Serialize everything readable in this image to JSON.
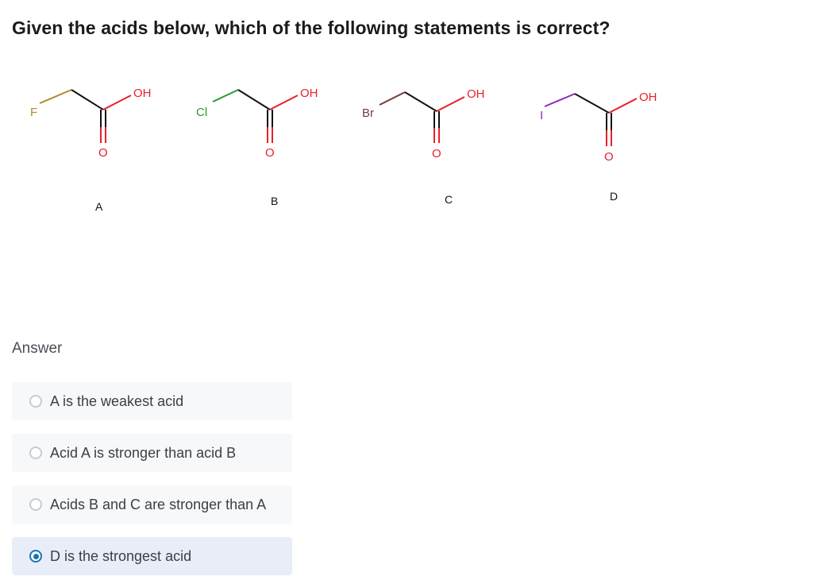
{
  "question": "Given the acids below, which of the following statements is correct?",
  "structures": [
    {
      "label": "A",
      "halogen": "F",
      "halogen_color": "#b0892a",
      "hydroxyl": "OH",
      "carbonyl_o": "O"
    },
    {
      "label": "B",
      "halogen": "Cl",
      "halogen_color": "#2e9a2e",
      "hydroxyl": "OH",
      "carbonyl_o": "O"
    },
    {
      "label": "C",
      "halogen": "Br",
      "halogen_color": "#7a3a3a",
      "hydroxyl": "OH",
      "carbonyl_o": "O"
    },
    {
      "label": "D",
      "halogen": "I",
      "halogen_color": "#8a2bc0",
      "hydroxyl": "OH",
      "carbonyl_o": "O"
    }
  ],
  "colors": {
    "oxygen": "#e8202a",
    "bond": "#111111",
    "accent": "#1a73b5"
  },
  "answer_label": "Answer",
  "options": [
    {
      "text": "A is the weakest acid",
      "selected": false
    },
    {
      "text": "Acid A is stronger than acid B",
      "selected": false
    },
    {
      "text": "Acids B and C are stronger than A",
      "selected": false
    },
    {
      "text": "D is the strongest acid",
      "selected": true
    }
  ]
}
